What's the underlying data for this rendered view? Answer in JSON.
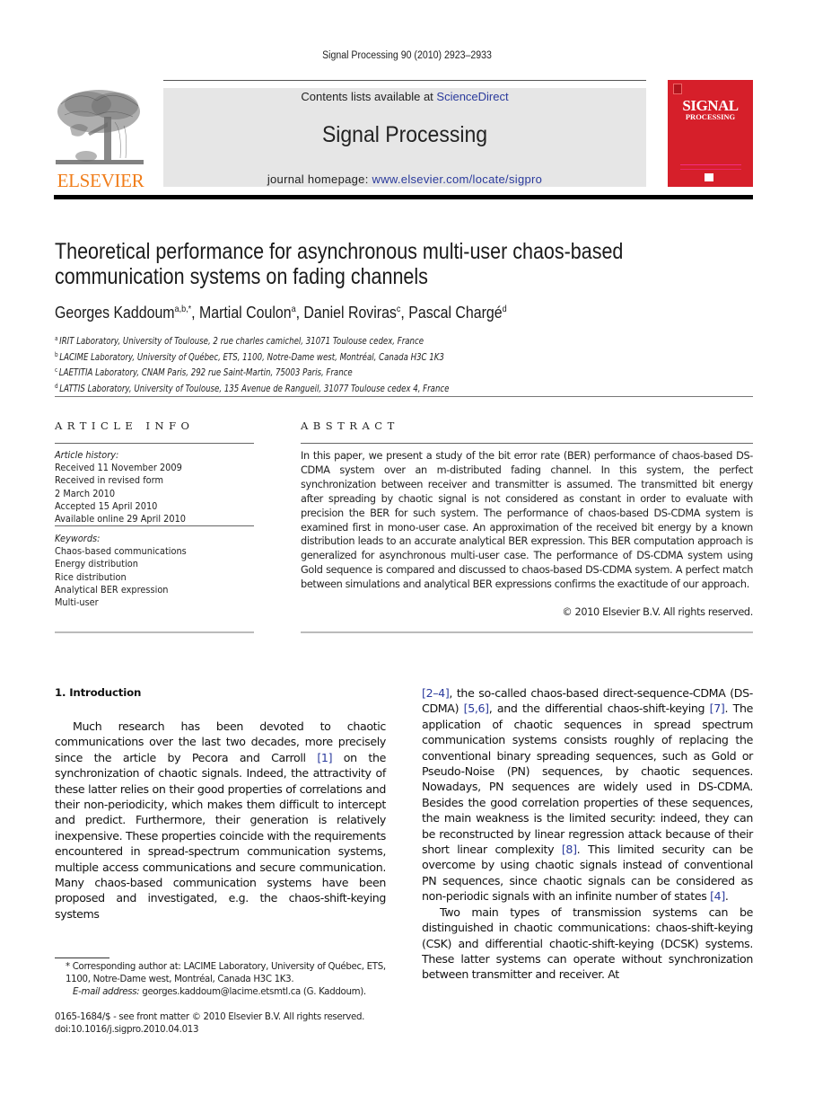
{
  "running_head": "Signal Processing 90 (2010) 2923–2933",
  "publisher": {
    "name": "ELSEVIER",
    "logo_icon": "elsevier-tree-icon",
    "brand_color": "#f07d1a"
  },
  "banner": {
    "contents_prefix": "Contents lists available at ",
    "contents_link": "ScienceDirect",
    "journal_title": "Signal Processing",
    "homepage_prefix": "journal homepage: ",
    "homepage_link": "www.elsevier.com/locate/sigpro",
    "link_color": "#2a3a9c",
    "background": "#e6e6e6"
  },
  "cover": {
    "title": "SIGNAL",
    "subtitle": "PROCESSING",
    "color": "#d61f2a"
  },
  "article": {
    "title_line1": "Theoretical performance for asynchronous multi-user chaos-based",
    "title_line2": "communication systems on fading channels",
    "authors": [
      {
        "name": "Georges Kaddoum",
        "sup": "a,b,*"
      },
      {
        "name": "Martial Coulon",
        "sup": "a"
      },
      {
        "name": "Daniel Roviras",
        "sup": "c"
      },
      {
        "name": "Pascal Chargé",
        "sup": "d"
      }
    ],
    "affiliations": [
      {
        "key": "a",
        "text": "IRIT Laboratory, University of Toulouse, 2 rue charles camichel, 31071 Toulouse cedex, France"
      },
      {
        "key": "b",
        "text": "LACIME Laboratory, University of Québec, ETS, 1100, Notre-Dame west, Montréal, Canada H3C 1K3"
      },
      {
        "key": "c",
        "text": "LAETITIA Laboratory, CNAM Paris, 292 rue Saint-Martin, 75003 Paris, France"
      },
      {
        "key": "d",
        "text": "LATTIS Laboratory, University of Toulouse, 135 Avenue de Rangueil, 31077 Toulouse cedex 4, France"
      }
    ]
  },
  "article_info": {
    "heading": "ARTICLE INFO",
    "history_label": "Article history:",
    "history": [
      "Received 11 November 2009",
      "Received in revised form",
      "2 March 2010",
      "Accepted 15 April 2010",
      "Available online 29 April 2010"
    ],
    "keywords_label": "Keywords:",
    "keywords": [
      "Chaos-based communications",
      "Energy distribution",
      "Rice distribution",
      "Analytical BER expression",
      "Multi-user"
    ]
  },
  "abstract": {
    "heading": "ABSTRACT",
    "text": "In this paper, we present a study of the bit error rate (BER) performance of chaos-based DS-CDMA system over an m-distributed fading channel. In this system, the perfect synchronization between receiver and transmitter is assumed. The transmitted bit energy after spreading by chaotic signal is not considered as constant in order to evaluate with precision the BER for such system. The performance of chaos-based DS-CDMA system is examined first in mono-user case. An approximation of the received bit energy by a known distribution leads to an accurate analytical BER expression. This BER computation approach is generalized for asynchronous multi-user case. The performance of DS-CDMA system using Gold sequence is compared and discussed to chaos-based DS-CDMA system. A perfect match between simulations and analytical BER expressions confirms the exactitude of our approach.",
    "copyright": "© 2010 Elsevier B.V. All rights reserved."
  },
  "introduction": {
    "heading": "1.  Introduction",
    "left_p1_a": "Much research has been devoted to chaotic communications over the last two decades, more precisely since the article by Pecora and Carroll ",
    "ref1": "[1]",
    "left_p1_b": " on the synchronization of chaotic signals. Indeed, the attractivity of these latter relies on their good properties of correlations and their non-periodicity, which makes them difficult to intercept and predict. Furthermore, their generation is relatively inexpensive. These properties coincide with the requirements encountered in spread-spectrum communication systems, multiple access communications and secure communication. Many chaos-based communication systems have been proposed and investigated, e.g. the chaos-shift-keying systems",
    "ref2": "[2–4]",
    "right_p1_a": ", the so-called chaos-based direct-sequence-CDMA (DS-CDMA) ",
    "ref3": "[5,6]",
    "right_p1_b": ", and the differential chaos-shift-keying ",
    "ref4": "[7]",
    "right_p1_c": ". The application of chaotic sequences in spread spectrum communication systems consists roughly of replacing the conventional binary spreading sequences, such as Gold or Pseudo-Noise (PN) sequences, by chaotic sequences. Nowadays, PN sequences are widely used in DS-CDMA. Besides the good correlation properties of these sequences, the main weakness is the limited security: indeed, they can be reconstructed by linear regression attack because of their short linear complexity ",
    "ref5": "[8]",
    "right_p1_d": ". This limited security can be overcome by using chaotic signals instead of conventional PN sequences, since chaotic signals can be considered as non-periodic signals with an infinite number of states ",
    "ref6": "[4]",
    "right_p1_e": ".",
    "right_p2": "Two main types of transmission systems can be distinguished in chaotic communications: chaos-shift-keying (CSK) and differential chaotic-shift-keying (DCSK) systems. These latter systems can operate without synchronization between transmitter and receiver. At"
  },
  "footnote": {
    "corresponding": "* Corresponding author at: LACIME Laboratory, University of Québec, ETS, 1100, Notre-Dame west, Montréal, Canada H3C 1K3.",
    "email_label": "E-mail address:",
    "email": " georges.kaddoum@lacime.etsmtl.ca (G. Kaddoum).",
    "issn": "0165-1684/$ - see front matter © 2010 Elsevier B.V. All rights reserved.",
    "doi": "doi:10.1016/j.sigpro.2010.04.013"
  }
}
